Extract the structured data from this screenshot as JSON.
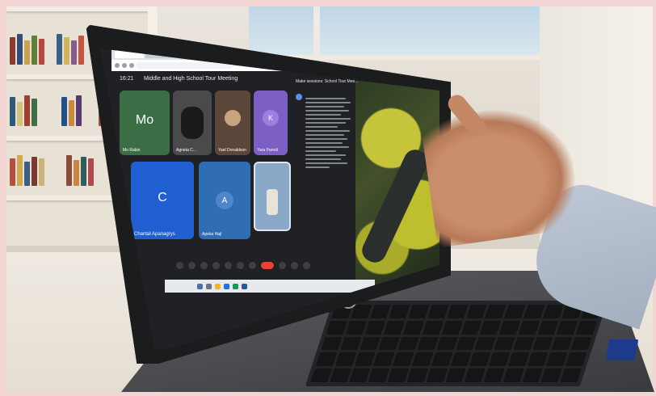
{
  "meeting": {
    "time": "16:21",
    "title": "Middle and High School Tour Meeting",
    "chat_heading": "Make sessions: School Tour Mee..."
  },
  "participants": [
    {
      "name": "Mo Rabin",
      "initial": "Mo",
      "color": "#3c6e46"
    },
    {
      "name": "Agneta C...",
      "initial": "",
      "color": "#4a4a4a"
    },
    {
      "name": "Yael Donaldson",
      "initial": "",
      "color": "#5b463a"
    },
    {
      "name": "Yara Paredi",
      "initial": "K",
      "color": "#7b5fc4"
    },
    {
      "name": "Chantal Apanagrys",
      "initial": "C",
      "color": "#1f5fd1"
    },
    {
      "name": "Apeka Hajl",
      "initial": "A",
      "color": "#2f6db5"
    },
    {
      "name": "",
      "initial": "",
      "color": "#8aa8c8"
    }
  ],
  "icons": [
    "mic-icon",
    "camera-icon",
    "present-icon",
    "reactions-icon",
    "more-icon",
    "end-call-icon"
  ],
  "colors": {
    "end_call": "#ea4335",
    "meet_background": "#202124"
  }
}
